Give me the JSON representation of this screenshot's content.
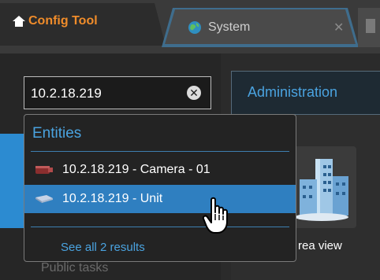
{
  "tabs": {
    "config_tool": "Config Tool",
    "system": "System",
    "close": "✕"
  },
  "search": {
    "value": "10.2.18.219"
  },
  "admin": {
    "label": "Administration"
  },
  "dropdown": {
    "header": "Entities",
    "items": [
      {
        "label": "10.2.18.219 - Camera - 01",
        "icon": "camera-icon",
        "selected": false
      },
      {
        "label": "10.2.18.219 - Unit",
        "icon": "unit-icon",
        "selected": true
      }
    ],
    "see_all": "See all 2 results"
  },
  "main": {
    "area_view_label": "rea view"
  },
  "sidebar": {
    "public_tasks": "Public tasks"
  },
  "colors": {
    "accent_blue": "#2f7fc0",
    "link_blue": "#4aa3e0",
    "config_orange": "#f08c2a"
  }
}
